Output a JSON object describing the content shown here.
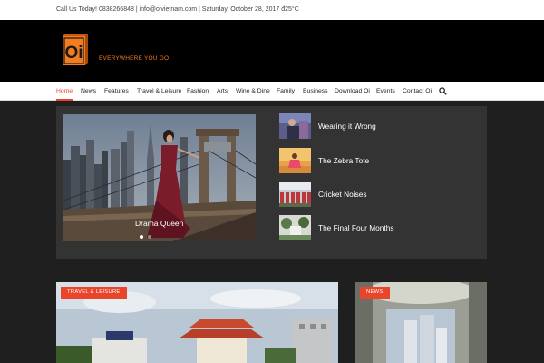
{
  "topbar": {
    "contact_text": "Call Us Today! 0838266848 | info@oivietnam.com | Saturday, October 28, 2017 đ25°C"
  },
  "logo": {
    "mark": "Oi",
    "tagline": "EVERYWHERE YOU GO",
    "brand_color": "#f47c20"
  },
  "nav": {
    "items": [
      {
        "label": "Home",
        "active": true
      },
      {
        "label": "News"
      },
      {
        "label": "Features"
      },
      {
        "label": "Travel & Leisure"
      },
      {
        "label": "Fashion"
      },
      {
        "label": "Arts"
      },
      {
        "label": "Wine & Dine"
      },
      {
        "label": "Family"
      },
      {
        "label": "Business"
      },
      {
        "label": "Download Oi"
      },
      {
        "label": "Events"
      },
      {
        "label": "Contact Oi"
      }
    ],
    "search_icon": "search-icon",
    "accent_color": "#e8452b"
  },
  "slider": {
    "featured": {
      "title": "Drama Queen"
    },
    "side_items": [
      {
        "title": "Wearing it Wrong"
      },
      {
        "title": "The Zebra Tote"
      },
      {
        "title": "Cricket Noises"
      },
      {
        "title": "The Final Four Months"
      }
    ]
  },
  "cards": [
    {
      "badge": "TRAVEL & LEISURE"
    },
    {
      "badge": "NEWS"
    }
  ]
}
